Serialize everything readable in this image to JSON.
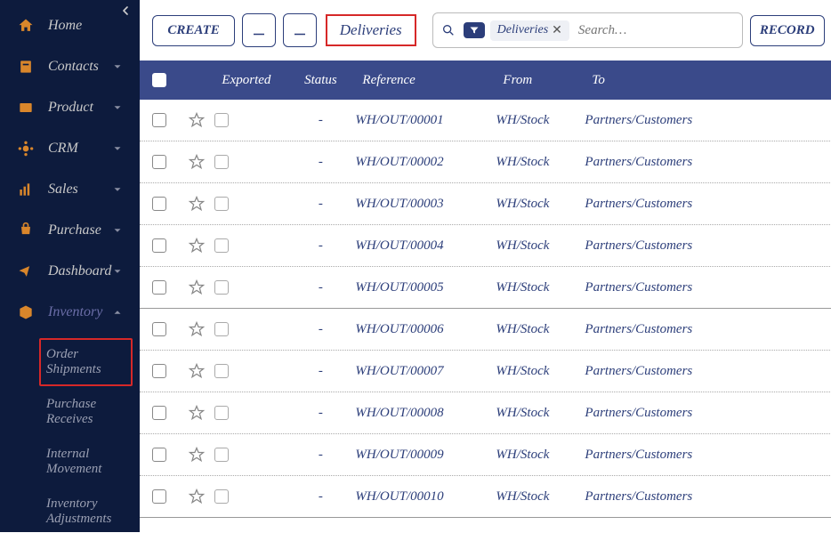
{
  "sidebar": {
    "items": [
      {
        "label": "Home",
        "icon": "home"
      },
      {
        "label": "Contacts",
        "icon": "contacts",
        "expandable": true
      },
      {
        "label": "Product",
        "icon": "product",
        "expandable": true
      },
      {
        "label": "CRM",
        "icon": "crm",
        "expandable": true
      },
      {
        "label": "Sales",
        "icon": "sales",
        "expandable": true
      },
      {
        "label": "Purchase",
        "icon": "purchase",
        "expandable": true
      },
      {
        "label": "Dashboard",
        "icon": "dashboard",
        "expandable": true
      },
      {
        "label": "Inventory",
        "icon": "inventory",
        "expandable": true,
        "expanded": true
      }
    ],
    "subitems": [
      {
        "label": "Order Shipments",
        "highlighted": true
      },
      {
        "label": "Purchase Receives"
      },
      {
        "label": "Internal Movement"
      },
      {
        "label": "Inventory Adjustments"
      }
    ]
  },
  "toolbar": {
    "create": "CREATE",
    "title": "Deliveries",
    "filter_tag": "Deliveries",
    "search_placeholder": "Search…",
    "record": "RECORD"
  },
  "table": {
    "headers": {
      "exported": "Exported",
      "status": "Status",
      "reference": "Reference",
      "from": "From",
      "to": "To"
    },
    "rows": [
      {
        "status": "-",
        "reference": "WH/OUT/00001",
        "from": "WH/Stock",
        "to": "Partners/Customers"
      },
      {
        "status": "-",
        "reference": "WH/OUT/00002",
        "from": "WH/Stock",
        "to": "Partners/Customers"
      },
      {
        "status": "-",
        "reference": "WH/OUT/00003",
        "from": "WH/Stock",
        "to": "Partners/Customers"
      },
      {
        "status": "-",
        "reference": "WH/OUT/00004",
        "from": "WH/Stock",
        "to": "Partners/Customers"
      },
      {
        "status": "-",
        "reference": "WH/OUT/00005",
        "from": "WH/Stock",
        "to": "Partners/Customers"
      },
      {
        "status": "-",
        "reference": "WH/OUT/00006",
        "from": "WH/Stock",
        "to": "Partners/Customers"
      },
      {
        "status": "-",
        "reference": "WH/OUT/00007",
        "from": "WH/Stock",
        "to": "Partners/Customers"
      },
      {
        "status": "-",
        "reference": "WH/OUT/00008",
        "from": "WH/Stock",
        "to": "Partners/Customers"
      },
      {
        "status": "-",
        "reference": "WH/OUT/00009",
        "from": "WH/Stock",
        "to": "Partners/Customers"
      },
      {
        "status": "-",
        "reference": "WH/OUT/00010",
        "from": "WH/Stock",
        "to": "Partners/Customers"
      }
    ]
  }
}
